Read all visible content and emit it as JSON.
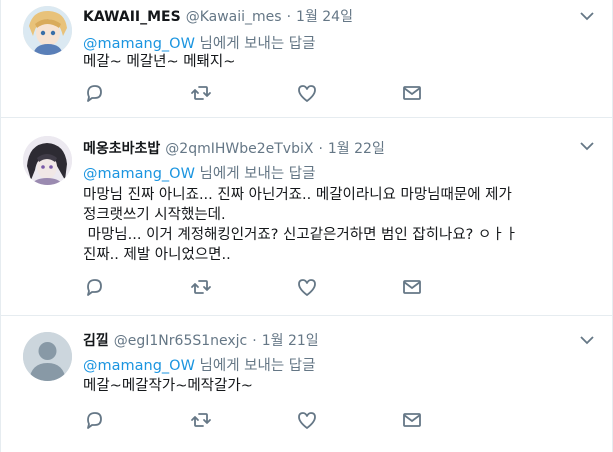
{
  "reply_prefix_suffix": "님에게 보내는 답글",
  "tweets": [
    {
      "fullname": "KAWAII_MES",
      "username": "@Kawaii_mes",
      "time": "1월 24일",
      "mention": "@mamang_OW",
      "text": "메갈~ 메갈년~ 메퇘지~"
    },
    {
      "fullname": "메옹초바초밥",
      "username": "@2qmIHWbe2eTvbiX",
      "time": "1월 22일",
      "mention": "@mamang_OW",
      "text_lines": [
        "마망님 진짜 아니죠... 진짜 아닌거죠.. 메갈이라니요 마망님때문에 제가",
        "정크랫쓰기 시작했는데.",
        " 마망님... 이거 계정해킹인거죠? 신고같은거하면 범인 잡히나요? ㅇㅏㅏ",
        "진짜.. 제발 아니었으면.."
      ]
    },
    {
      "fullname": "김낄",
      "username": "@egI1Nr65S1nexjc",
      "time": "1월 21일",
      "mention": "@mamang_OW",
      "text": "메갈~메갈작가~메작갈가~"
    }
  ],
  "icons": {
    "reply": "reply-icon",
    "retweet": "retweet-icon",
    "like": "heart-icon",
    "dm": "envelope-icon",
    "more": "chevron-down-icon"
  },
  "colors": {
    "mention": "#1b95e0",
    "secondary_text": "#657786",
    "icon": "#657786",
    "border": "#e6ecf0"
  }
}
